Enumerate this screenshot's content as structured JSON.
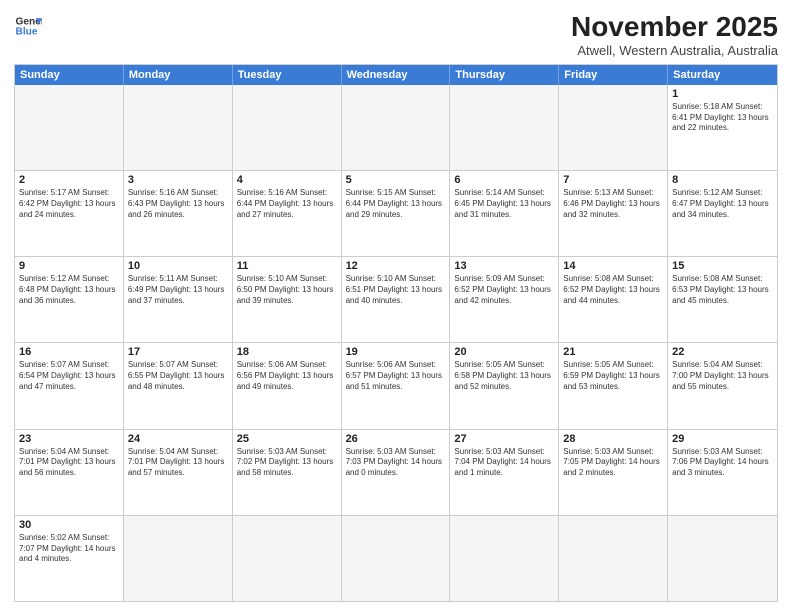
{
  "header": {
    "logo_line1": "General",
    "logo_line2": "Blue",
    "month": "November 2025",
    "location": "Atwell, Western Australia, Australia"
  },
  "days_of_week": [
    "Sunday",
    "Monday",
    "Tuesday",
    "Wednesday",
    "Thursday",
    "Friday",
    "Saturday"
  ],
  "weeks": [
    [
      {
        "day": "",
        "info": ""
      },
      {
        "day": "",
        "info": ""
      },
      {
        "day": "",
        "info": ""
      },
      {
        "day": "",
        "info": ""
      },
      {
        "day": "",
        "info": ""
      },
      {
        "day": "",
        "info": ""
      },
      {
        "day": "1",
        "info": "Sunrise: 5:18 AM\nSunset: 6:41 PM\nDaylight: 13 hours\nand 22 minutes."
      }
    ],
    [
      {
        "day": "2",
        "info": "Sunrise: 5:17 AM\nSunset: 6:42 PM\nDaylight: 13 hours\nand 24 minutes."
      },
      {
        "day": "3",
        "info": "Sunrise: 5:16 AM\nSunset: 6:43 PM\nDaylight: 13 hours\nand 26 minutes."
      },
      {
        "day": "4",
        "info": "Sunrise: 5:16 AM\nSunset: 6:44 PM\nDaylight: 13 hours\nand 27 minutes."
      },
      {
        "day": "5",
        "info": "Sunrise: 5:15 AM\nSunset: 6:44 PM\nDaylight: 13 hours\nand 29 minutes."
      },
      {
        "day": "6",
        "info": "Sunrise: 5:14 AM\nSunset: 6:45 PM\nDaylight: 13 hours\nand 31 minutes."
      },
      {
        "day": "7",
        "info": "Sunrise: 5:13 AM\nSunset: 6:46 PM\nDaylight: 13 hours\nand 32 minutes."
      },
      {
        "day": "8",
        "info": "Sunrise: 5:12 AM\nSunset: 6:47 PM\nDaylight: 13 hours\nand 34 minutes."
      }
    ],
    [
      {
        "day": "9",
        "info": "Sunrise: 5:12 AM\nSunset: 6:48 PM\nDaylight: 13 hours\nand 36 minutes."
      },
      {
        "day": "10",
        "info": "Sunrise: 5:11 AM\nSunset: 6:49 PM\nDaylight: 13 hours\nand 37 minutes."
      },
      {
        "day": "11",
        "info": "Sunrise: 5:10 AM\nSunset: 6:50 PM\nDaylight: 13 hours\nand 39 minutes."
      },
      {
        "day": "12",
        "info": "Sunrise: 5:10 AM\nSunset: 6:51 PM\nDaylight: 13 hours\nand 40 minutes."
      },
      {
        "day": "13",
        "info": "Sunrise: 5:09 AM\nSunset: 6:52 PM\nDaylight: 13 hours\nand 42 minutes."
      },
      {
        "day": "14",
        "info": "Sunrise: 5:08 AM\nSunset: 6:52 PM\nDaylight: 13 hours\nand 44 minutes."
      },
      {
        "day": "15",
        "info": "Sunrise: 5:08 AM\nSunset: 6:53 PM\nDaylight: 13 hours\nand 45 minutes."
      }
    ],
    [
      {
        "day": "16",
        "info": "Sunrise: 5:07 AM\nSunset: 6:54 PM\nDaylight: 13 hours\nand 47 minutes."
      },
      {
        "day": "17",
        "info": "Sunrise: 5:07 AM\nSunset: 6:55 PM\nDaylight: 13 hours\nand 48 minutes."
      },
      {
        "day": "18",
        "info": "Sunrise: 5:06 AM\nSunset: 6:56 PM\nDaylight: 13 hours\nand 49 minutes."
      },
      {
        "day": "19",
        "info": "Sunrise: 5:06 AM\nSunset: 6:57 PM\nDaylight: 13 hours\nand 51 minutes."
      },
      {
        "day": "20",
        "info": "Sunrise: 5:05 AM\nSunset: 6:58 PM\nDaylight: 13 hours\nand 52 minutes."
      },
      {
        "day": "21",
        "info": "Sunrise: 5:05 AM\nSunset: 6:59 PM\nDaylight: 13 hours\nand 53 minutes."
      },
      {
        "day": "22",
        "info": "Sunrise: 5:04 AM\nSunset: 7:00 PM\nDaylight: 13 hours\nand 55 minutes."
      }
    ],
    [
      {
        "day": "23",
        "info": "Sunrise: 5:04 AM\nSunset: 7:01 PM\nDaylight: 13 hours\nand 56 minutes."
      },
      {
        "day": "24",
        "info": "Sunrise: 5:04 AM\nSunset: 7:01 PM\nDaylight: 13 hours\nand 57 minutes."
      },
      {
        "day": "25",
        "info": "Sunrise: 5:03 AM\nSunset: 7:02 PM\nDaylight: 13 hours\nand 58 minutes."
      },
      {
        "day": "26",
        "info": "Sunrise: 5:03 AM\nSunset: 7:03 PM\nDaylight: 14 hours\nand 0 minutes."
      },
      {
        "day": "27",
        "info": "Sunrise: 5:03 AM\nSunset: 7:04 PM\nDaylight: 14 hours\nand 1 minute."
      },
      {
        "day": "28",
        "info": "Sunrise: 5:03 AM\nSunset: 7:05 PM\nDaylight: 14 hours\nand 2 minutes."
      },
      {
        "day": "29",
        "info": "Sunrise: 5:03 AM\nSunset: 7:06 PM\nDaylight: 14 hours\nand 3 minutes."
      }
    ],
    [
      {
        "day": "30",
        "info": "Sunrise: 5:02 AM\nSunset: 7:07 PM\nDaylight: 14 hours\nand 4 minutes."
      },
      {
        "day": "",
        "info": ""
      },
      {
        "day": "",
        "info": ""
      },
      {
        "day": "",
        "info": ""
      },
      {
        "day": "",
        "info": ""
      },
      {
        "day": "",
        "info": ""
      },
      {
        "day": "",
        "info": ""
      }
    ]
  ]
}
